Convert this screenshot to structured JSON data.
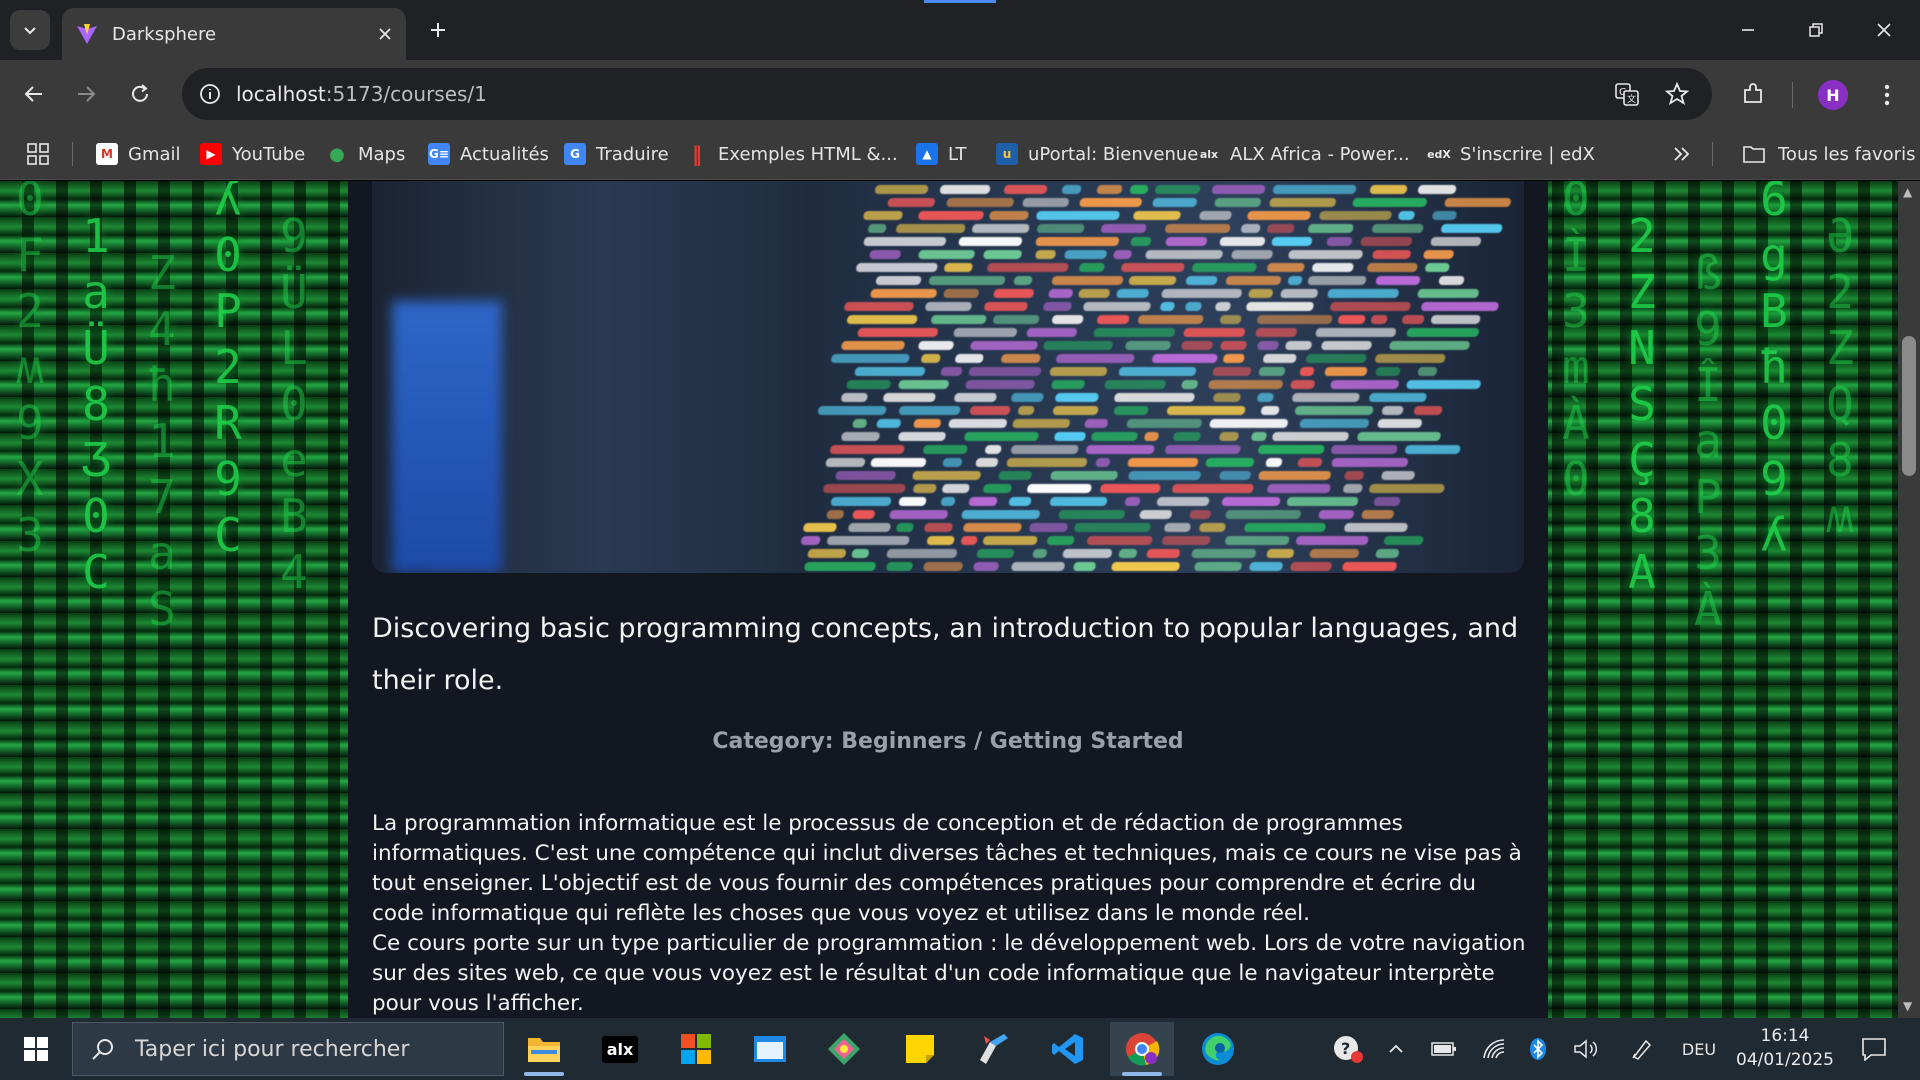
{
  "browser": {
    "tab_title": "Darksphere",
    "url_host": "localhost",
    "url_path": ":5173/courses/1",
    "profile_initial": "H",
    "bookmarks": [
      {
        "label": "Gmail",
        "icon": "gmail-icon"
      },
      {
        "label": "YouTube",
        "icon": "youtube-icon"
      },
      {
        "label": "Maps",
        "icon": "maps-icon"
      },
      {
        "label": "Actualités",
        "icon": "news-icon"
      },
      {
        "label": "Traduire",
        "icon": "translate-icon"
      },
      {
        "label": "Exemples HTML &...",
        "icon": "html-examples-icon"
      },
      {
        "label": "LT",
        "icon": "lt-icon"
      },
      {
        "label": "uPortal: Bienvenue",
        "icon": "uportal-icon"
      },
      {
        "label": "ALX Africa - Power...",
        "icon": "alx-icon"
      },
      {
        "label": "S'inscrire | edX",
        "icon": "edx-icon"
      }
    ],
    "all_bookmarks_label": "Tous les favoris"
  },
  "course": {
    "description": "Discovering basic programming concepts, an introduction to popular languages, and their role.",
    "category": "Category: Beginners / Getting Started",
    "paragraph_1": "La programmation informatique est le processus de conception et de rédaction de programmes informatiques. C'est une compétence qui inclut diverses tâches et techniques, mais ce cours ne vise pas à tout enseigner. L'objectif est de vous fournir des compétences pratiques pour comprendre et écrire du code informatique qui reflète les choses que vous voyez et utilisez dans le monde réel.",
    "paragraph_2": "Ce cours porte sur un type particulier de programmation : le développement web. Lors de votre navigation sur des sites web, ce que vous voyez est le résultat d'un code informatique que le navigateur interprète pour vous l'afficher."
  },
  "taskbar": {
    "search_placeholder": "Taper ici pour rechercher",
    "language": "DEU",
    "time": "16:14",
    "date": "04/01/2025",
    "alx_label": "alx"
  },
  "matrix": {
    "left_columns": [
      "0F2ʍ9X3",
      "1aÜ8Ʒ0C",
      "Z4ħ17aS",
      "ʎ0P2R9C",
      "9ÜL0eB4"
    ],
    "right_columns": [
      "0Ì3mÀ0",
      "2ZNSÇ8A",
      "ß9ÎaP3À",
      "6gBħ09ʎ",
      "Ә2ZQ8ʍ"
    ]
  },
  "colors": {
    "chrome_dark": "#202124",
    "chrome_toolbar": "#3a3a3a",
    "page_bg": "#131722",
    "matrix_green": "#1fcf4a",
    "category_gray": "#9aa0a8",
    "profile_purple": "#8a2fc4"
  }
}
